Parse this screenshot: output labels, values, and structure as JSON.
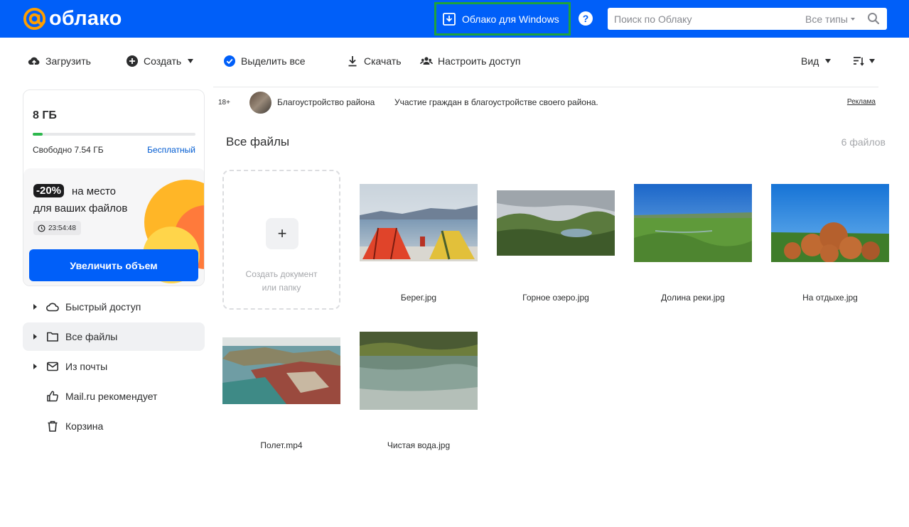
{
  "header": {
    "logo_text": "облако",
    "windows_button_label": "Облако для Windows",
    "help_label": "?",
    "search_placeholder": "Поиск по Облаку",
    "search_types_label": "Все типы"
  },
  "toolbar": {
    "upload_label": "Загрузить",
    "create_label": "Создать",
    "select_all_label": "Выделить все",
    "download_label": "Скачать",
    "share_label": "Настроить доступ",
    "view_label": "Вид"
  },
  "storage": {
    "total": "8 ГБ",
    "used_fraction": 0.06,
    "free_text": "Свободно 7.54 ГБ",
    "plan_label": "Бесплатный"
  },
  "promo": {
    "badge": "-20%",
    "line1": "на место",
    "line2": "для ваших файлов",
    "timer": "23:54:48",
    "button_label": "Увеличить объем"
  },
  "sidebar": {
    "items": [
      {
        "label": "Быстрый доступ",
        "icon": "cloud-icon",
        "expandable": true,
        "active": false
      },
      {
        "label": "Все файлы",
        "icon": "folder-icon",
        "expandable": true,
        "active": true
      },
      {
        "label": "Из почты",
        "icon": "mail-icon",
        "expandable": true,
        "active": false
      },
      {
        "label": "Mail.ru рекомендует",
        "icon": "thumbs-up-icon",
        "expandable": false,
        "active": false
      },
      {
        "label": "Корзина",
        "icon": "trash-icon",
        "expandable": false,
        "active": false
      }
    ]
  },
  "ad": {
    "age": "18+",
    "title": "Благоустройство района",
    "text": "Участие граждан в благоустройстве своего района.",
    "link": "Реклама"
  },
  "main": {
    "section_title": "Все файлы",
    "file_count": "6 файлов",
    "create_tile": {
      "plus": "+",
      "line1": "Создать документ",
      "line2": "или папку"
    },
    "files": [
      {
        "name": "Берег.jpg"
      },
      {
        "name": "Горное озеро.jpg"
      },
      {
        "name": "Долина реки.jpg"
      },
      {
        "name": "На отдыхе.jpg"
      },
      {
        "name": "Полет.mp4"
      },
      {
        "name": "Чистая вода.jpg"
      }
    ]
  },
  "colors": {
    "brand_blue": "#005ff9",
    "highlight_green": "#1fa33b",
    "storage_green": "#2db84d",
    "promo_orange": "#ffb627"
  }
}
